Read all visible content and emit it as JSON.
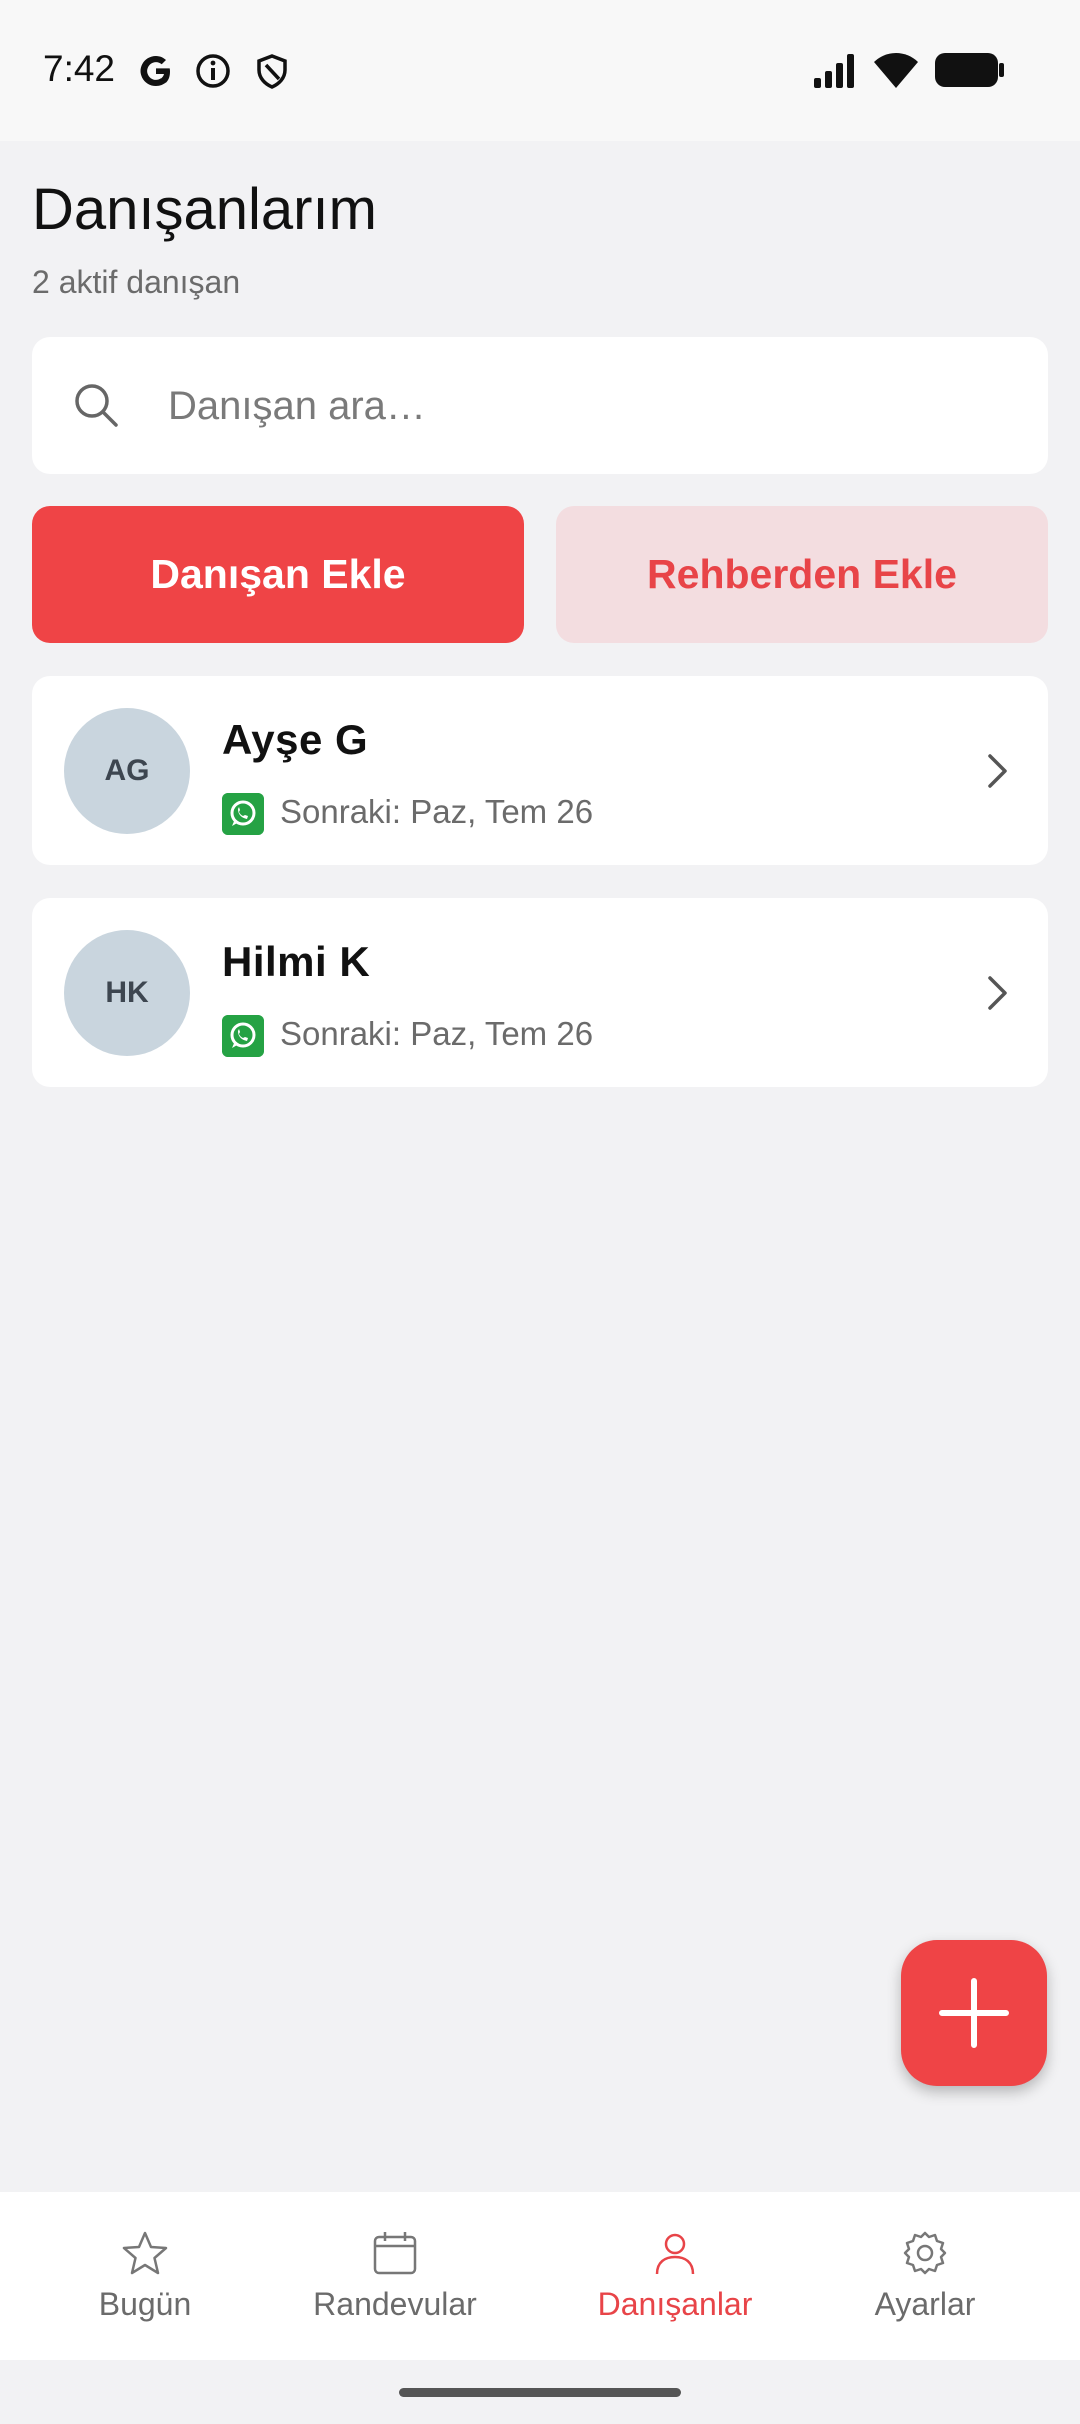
{
  "status_bar": {
    "time": "7:42",
    "icons_left": [
      "google-g-icon",
      "info-icon",
      "shield-icon"
    ],
    "icons_right": [
      "signal-icon",
      "wifi-icon",
      "battery-icon"
    ]
  },
  "header": {
    "title": "Danışanlarım",
    "subtitle": "2 aktif danışan"
  },
  "search": {
    "placeholder": "Danışan ara…",
    "value": ""
  },
  "actions": {
    "add_client": "Danışan Ekle",
    "add_from_contacts": "Rehberden Ekle"
  },
  "clients": [
    {
      "initials": "AG",
      "name": "Ayşe G",
      "next": "Sonraki: Paz, Tem 26",
      "channel": "whatsapp-icon"
    },
    {
      "initials": "HK",
      "name": "Hilmi K",
      "next": "Sonraki: Paz, Tem 26",
      "channel": "whatsapp-icon"
    }
  ],
  "fab": {
    "icon": "plus-icon"
  },
  "bottom_nav": {
    "items": [
      {
        "label": "Bugün",
        "icon": "star-icon"
      },
      {
        "label": "Randevular",
        "icon": "calendar-icon"
      },
      {
        "label": "Danışanlar",
        "icon": "person-icon",
        "active": true
      },
      {
        "label": "Ayarlar",
        "icon": "gear-icon"
      }
    ]
  },
  "colors": {
    "accent": "#ef4446",
    "accent_soft": "#f3dde0",
    "background": "#f2f2f4",
    "avatar": "#c9d5de",
    "whatsapp": "#25a244"
  }
}
